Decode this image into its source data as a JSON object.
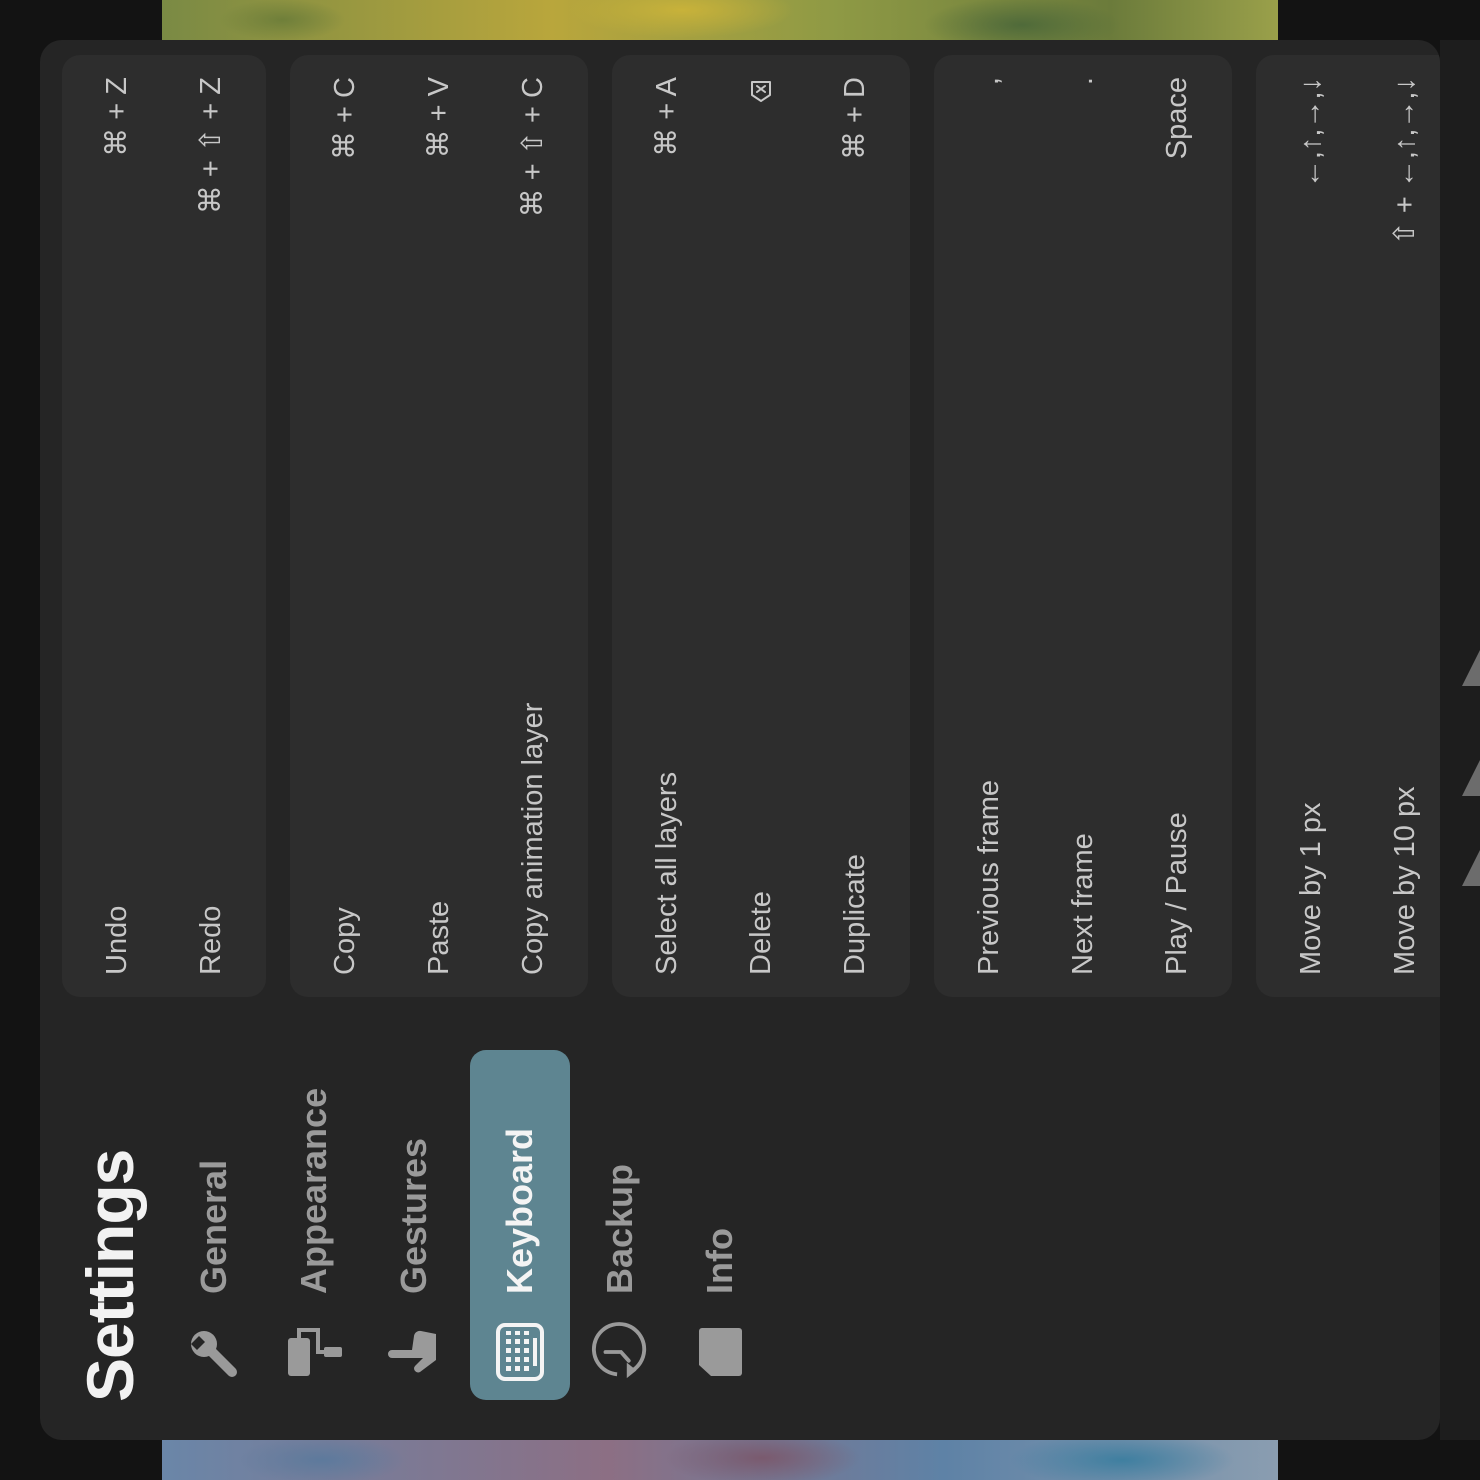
{
  "settings": {
    "title": "Settings",
    "nav": [
      {
        "label": "General",
        "icon": "wrench-icon",
        "active": false
      },
      {
        "label": "Appearance",
        "icon": "paint-roller-icon",
        "active": false
      },
      {
        "label": "Gestures",
        "icon": "hand-pointer-icon",
        "active": false
      },
      {
        "label": "Keyboard",
        "icon": "keyboard-icon",
        "active": true
      },
      {
        "label": "Backup",
        "icon": "history-clock-icon",
        "active": false
      },
      {
        "label": "Info",
        "icon": "document-icon",
        "active": false
      }
    ]
  },
  "shortcuts": {
    "edit": [
      {
        "label": "Undo",
        "key": "⌘ + Z"
      },
      {
        "label": "Redo",
        "key": "⌘ + ⇧ + Z"
      }
    ],
    "clipboard": [
      {
        "label": "Copy",
        "key": "⌘ + C"
      },
      {
        "label": "Paste",
        "key": "⌘ + V"
      },
      {
        "label": "Copy animation layer",
        "key": "⌘ + ⇧ + C"
      }
    ],
    "layers": [
      {
        "label": "Select all layers",
        "key": "⌘ + A"
      },
      {
        "label": "Delete",
        "key": "",
        "key_icon": "delete-key-icon"
      },
      {
        "label": "Duplicate",
        "key": "⌘ + D"
      }
    ],
    "playback": [
      {
        "label": "Previous frame",
        "key": ","
      },
      {
        "label": "Next frame",
        "key": "."
      },
      {
        "label": "Play / Pause",
        "key": "Space"
      }
    ],
    "move": [
      {
        "label": "Move by 1 px",
        "key": "←,↑,→,↓"
      },
      {
        "label": "Move by 10 px",
        "key": "⇧ + ←,↑,→,↓"
      }
    ]
  },
  "colors": {
    "accent": "#5e8591",
    "panel": "#252525",
    "group": "#2d2d2d",
    "text": "#c7c7c7"
  }
}
